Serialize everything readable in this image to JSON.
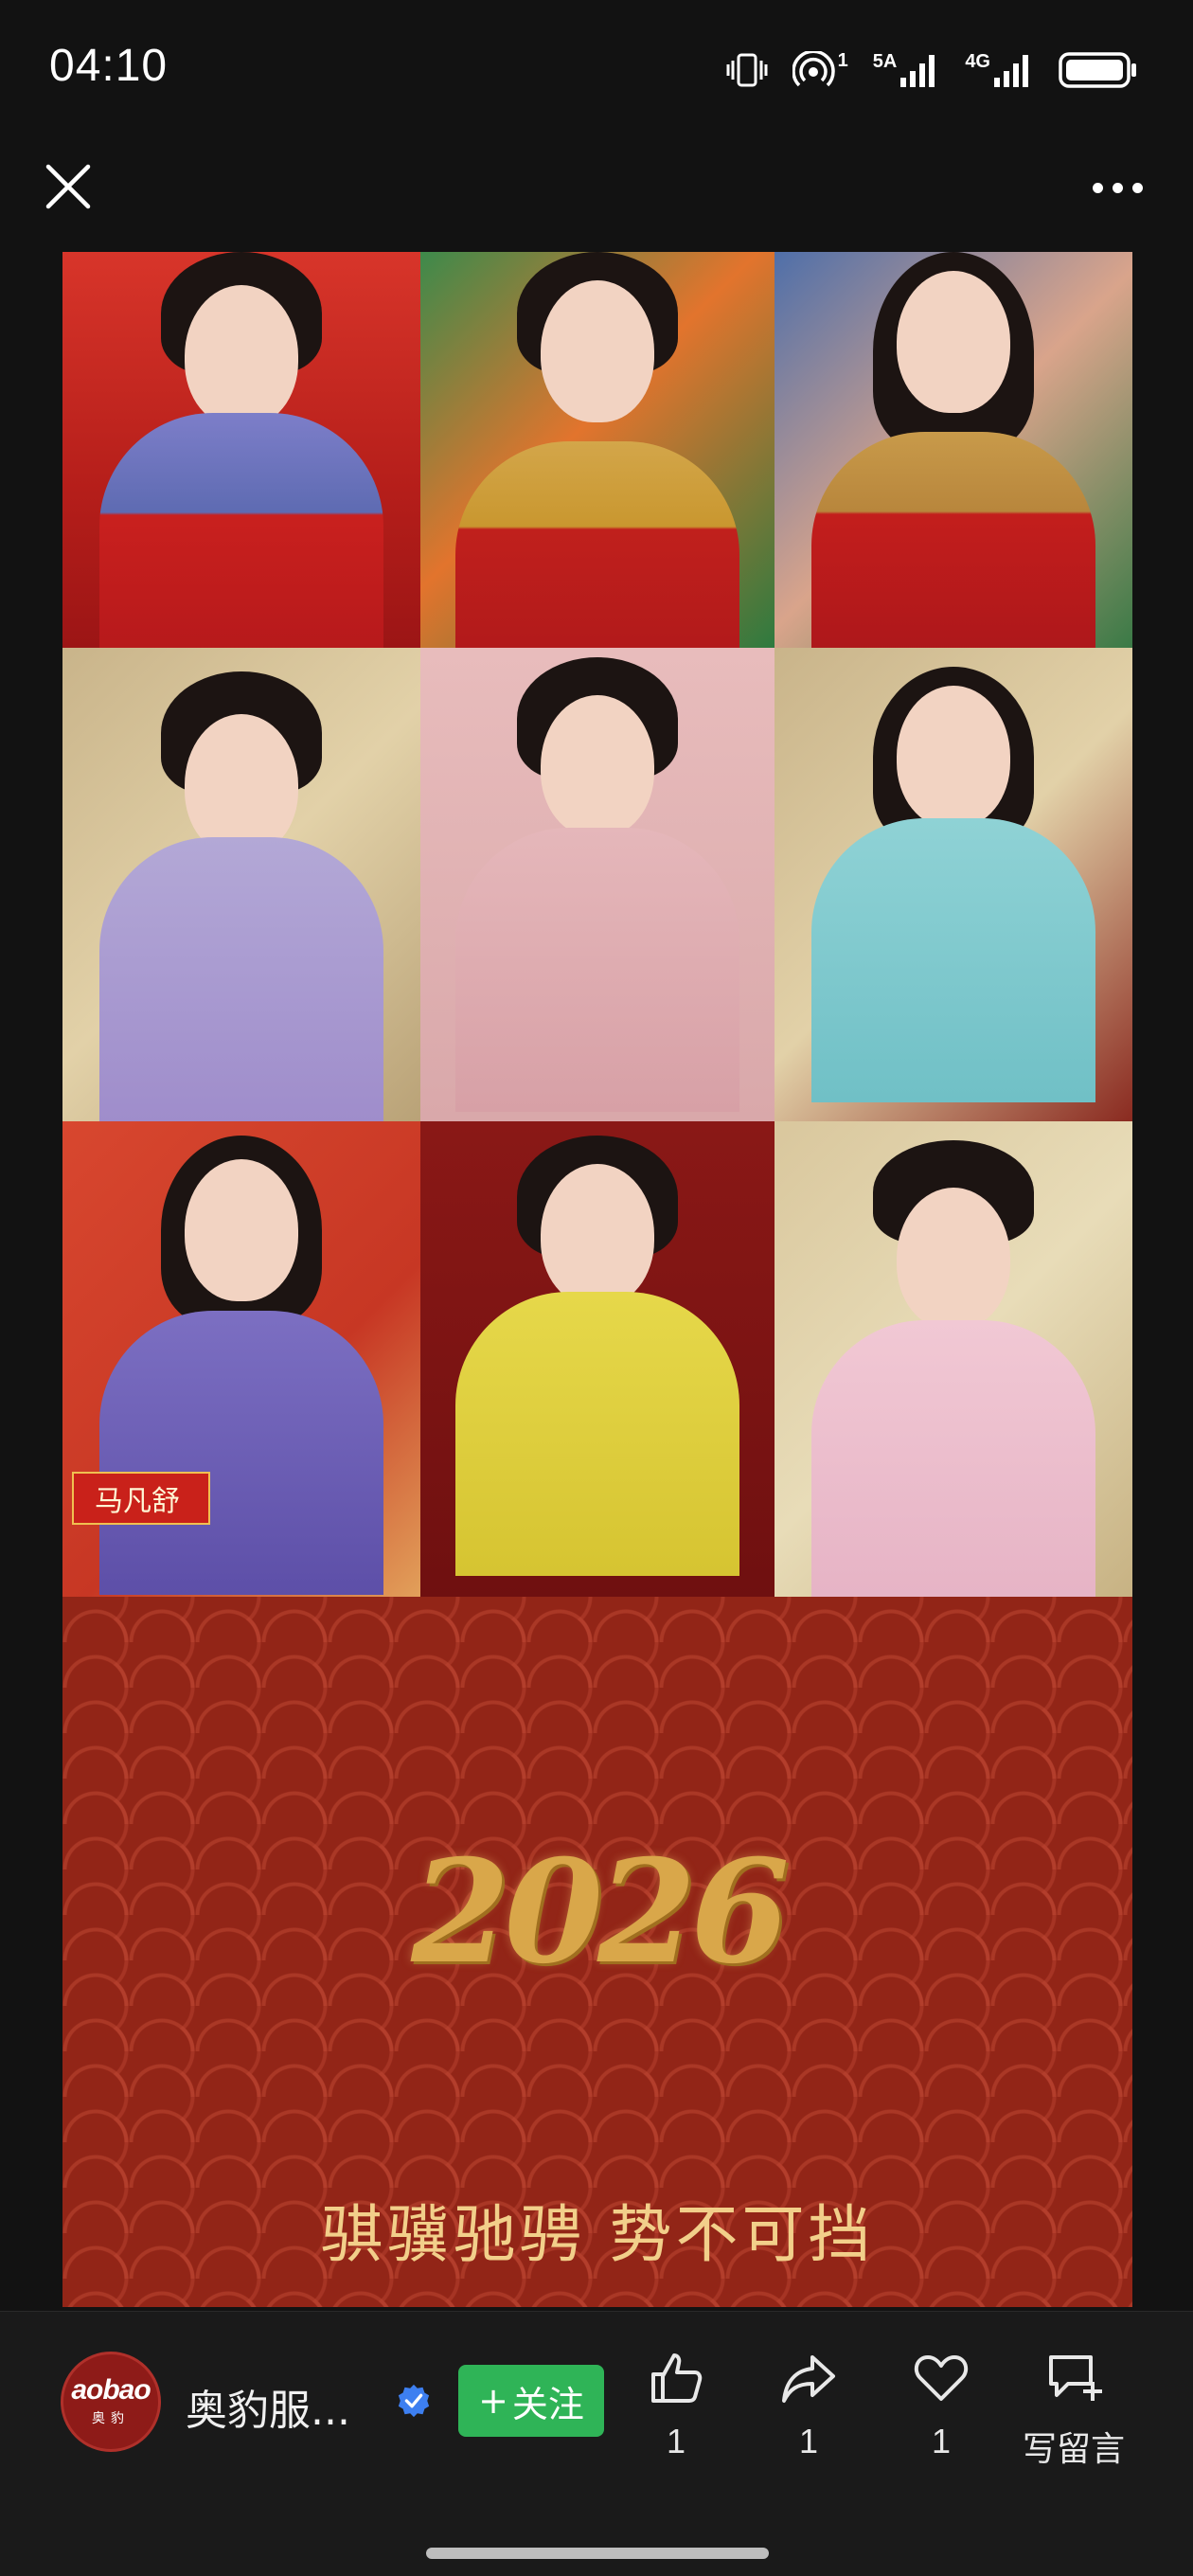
{
  "status_bar": {
    "time": "04:10",
    "hotspot_badge": "1",
    "network_5a": "5A",
    "network_4g": "4G"
  },
  "nav": {
    "close_icon": "close-icon",
    "more_icon": "more-icon"
  },
  "content": {
    "nameplate": "马凡舒",
    "year": "2026",
    "slogan": "骐骥驰骋 势不可挡",
    "colors": {
      "background_red": "#922517",
      "gold": "#d9a74a"
    }
  },
  "bottom_bar": {
    "avatar_logo": "aobao",
    "avatar_sub": "奥豹",
    "account_name": "奥豹服...",
    "follow_label": "关注",
    "like_count": "1",
    "share_count": "1",
    "favorite_count": "1",
    "comment_label": "写留言",
    "follow_color": "#2fb457"
  }
}
